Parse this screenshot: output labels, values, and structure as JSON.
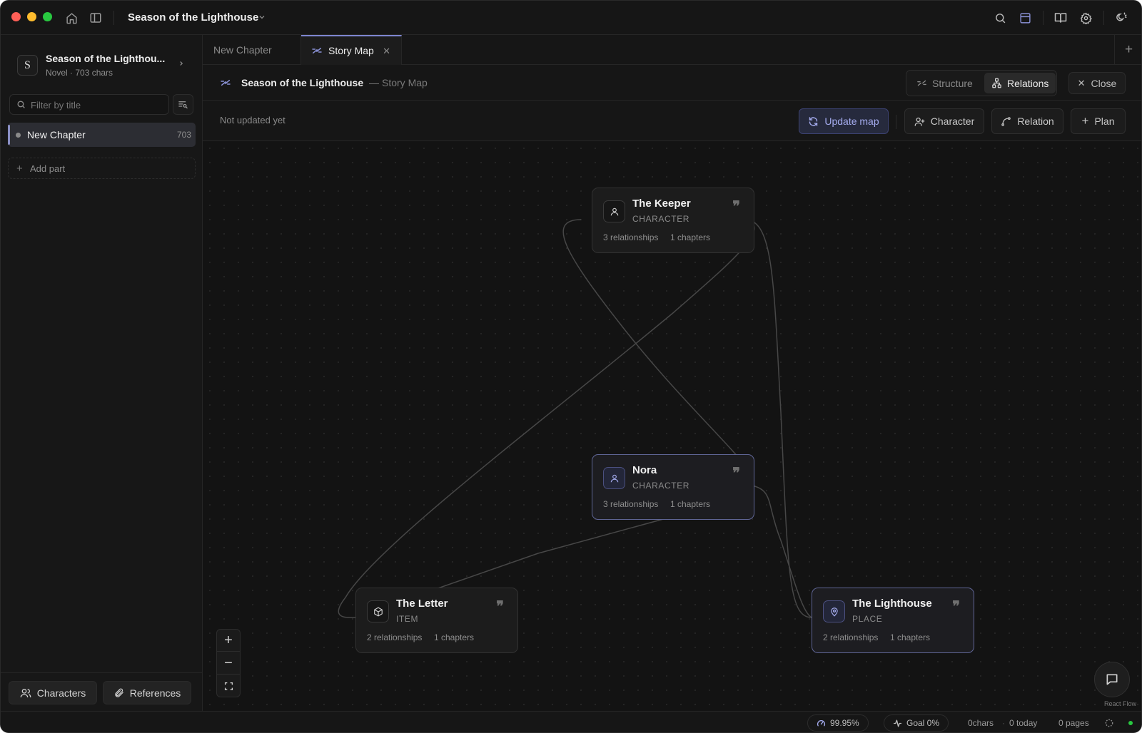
{
  "window": {
    "title": "Season of the Lighthouse"
  },
  "titlebar": {
    "icons": [
      "home-icon",
      "sidebar-toggle-icon",
      "chevron-down-icon",
      "search-icon",
      "layout-panel-icon",
      "book-open-icon",
      "gear-icon",
      "theme-toggle-icon"
    ]
  },
  "sidebar": {
    "project": {
      "initial": "S",
      "title": "Season of the Lighthou...",
      "meta": "Novel · 703 chars"
    },
    "filter": {
      "placeholder": "Filter by title",
      "value": ""
    },
    "chapters": [
      {
        "label": "New Chapter",
        "count": "703"
      }
    ],
    "add_part_label": "Add part",
    "footer": {
      "characters_label": "Characters",
      "references_label": "References"
    }
  },
  "tabs": [
    {
      "label": "New Chapter",
      "active": false
    },
    {
      "label": "Story Map",
      "active": true
    }
  ],
  "header": {
    "title": "Season of the Lighthouse",
    "separator": "—",
    "subtitle": "Story Map",
    "views": {
      "structure": "Structure",
      "relations": "Relations"
    },
    "active_view": "Relations",
    "close_label": "Close"
  },
  "toolbar": {
    "status": "Not updated yet",
    "update_label": "Update map",
    "character_label": "Character",
    "relation_label": "Relation",
    "plan_label": "Plan"
  },
  "nodes": [
    {
      "id": "keeper",
      "name": "The Keeper",
      "type": "CHARACTER",
      "relationships": "3 relationships",
      "chapters": "1 chapters",
      "icon": "user-icon"
    },
    {
      "id": "nora",
      "name": "Nora",
      "type": "CHARACTER",
      "relationships": "3 relationships",
      "chapters": "1 chapters",
      "icon": "user-icon"
    },
    {
      "id": "letter",
      "name": "The Letter",
      "type": "ITEM",
      "relationships": "2 relationships",
      "chapters": "1 chapters",
      "icon": "box-icon"
    },
    {
      "id": "lighthouse",
      "name": "The Lighthouse",
      "type": "PLACE",
      "relationships": "2 relationships",
      "chapters": "1 chapters",
      "icon": "map-pin-icon"
    }
  ],
  "canvas": {
    "attribution": "React Flow"
  },
  "statusbar": {
    "progress": "99.95%",
    "goal": "Goal 0%",
    "chars": "0chars",
    "today": "0 today",
    "pages": "0 pages"
  },
  "colors": {
    "accent": "#7e86d0",
    "background": "#141414",
    "node_border_selected": "#5f6595",
    "status_ok": "#28c840"
  }
}
